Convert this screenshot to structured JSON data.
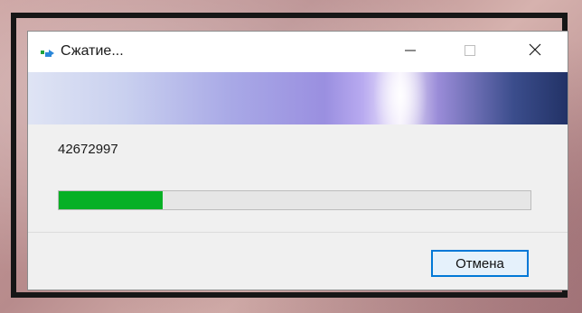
{
  "window": {
    "title": "Сжатие...",
    "file_name": "42672997",
    "progress": 0.22
  },
  "buttons": {
    "cancel_label": "Отмена"
  },
  "icons": {
    "app": "compress-icon",
    "minimize": "minimize-icon",
    "maximize": "maximize-icon",
    "close": "close-icon"
  },
  "colors": {
    "progress_fill": "#06b025",
    "accent_border": "#0078d7"
  }
}
